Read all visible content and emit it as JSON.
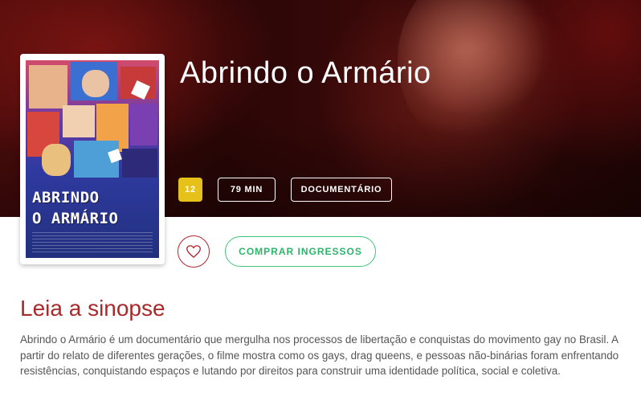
{
  "movie": {
    "title": "Abrindo o Armário",
    "poster": {
      "title_line1": "ABRINDO",
      "title_line2": "O ARMÁRIO"
    },
    "badges": {
      "age_rating": "12",
      "duration": "79 MIN",
      "genre": "DOCUMENTÁRIO"
    },
    "colors": {
      "age_badge": "#e6c11a",
      "accent_red": "#a82a2a",
      "buy_green": "#2eb46a"
    }
  },
  "actions": {
    "favorite_icon": "heart-icon",
    "buy_label": "COMPRAR INGRESSOS"
  },
  "synopsis": {
    "heading": "Leia a sinopse",
    "text": "Abrindo o Armário é um documentário que mergulha nos processos de libertação e conquistas do movimento gay no Brasil. A partir do relato de diferentes gerações, o filme mostra como os gays, drag queens, e pessoas não-binárias foram enfrentando resistências, conquistando espaços e lutando por direitos para construir uma identidade política, social e coletiva."
  }
}
